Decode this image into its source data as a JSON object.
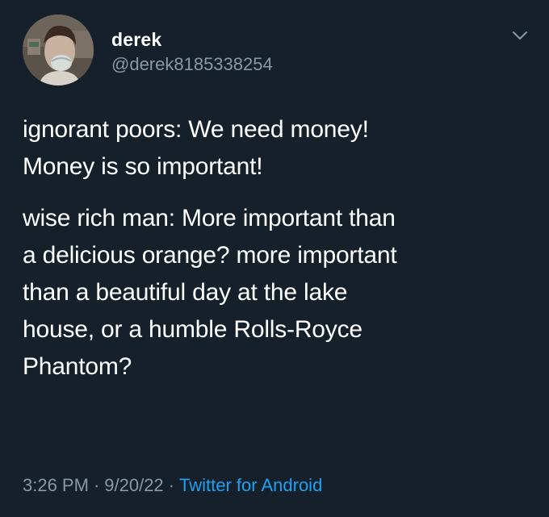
{
  "user": {
    "display_name": "derek",
    "handle": "@derek8185338254"
  },
  "tweet": {
    "paragraphs": [
      "ignorant poors: We need money!\nMoney is so important!",
      "wise rich man: More important than\na delicious orange? more important\nthan a beautiful day at the lake\nhouse, or a humble Rolls-Royce\nPhantom?"
    ],
    "time": "3:26 PM",
    "date": "9/20/22",
    "separator": "·",
    "source": "Twitter for Android"
  },
  "icons": {
    "menu": "chevron-down-icon",
    "avatar": "profile-photo"
  },
  "colors": {
    "background": "#15202b",
    "text": "#ffffff",
    "secondary_text": "#8899a6",
    "link": "#1da1f2"
  }
}
